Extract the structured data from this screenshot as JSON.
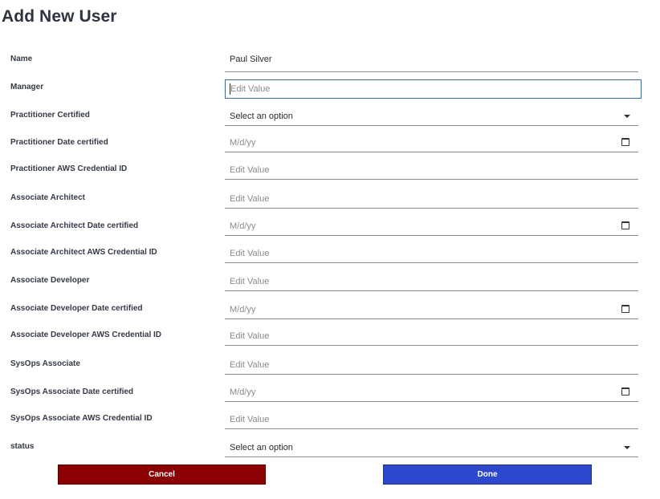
{
  "form": {
    "title": "Add New User",
    "fields": [
      {
        "label": "Name",
        "value": "Paul Silver",
        "placeholder": ""
      },
      {
        "label": "Manager",
        "value": "",
        "placeholder": "Edit Value"
      },
      {
        "label": "Practitioner Certified",
        "value": "Select an option",
        "placeholder": ""
      },
      {
        "label": "Practitioner Date certified",
        "value": "",
        "placeholder": "M/d/yy"
      },
      {
        "label": "Practitioner AWS Credential ID",
        "value": "",
        "placeholder": "Edit Value"
      },
      {
        "label": "Associate Architect",
        "value": "",
        "placeholder": "Edit Value"
      },
      {
        "label": "Associate Architect Date certified",
        "value": "",
        "placeholder": "M/d/yy"
      },
      {
        "label": "Associate Architect AWS Credential ID",
        "value": "",
        "placeholder": "Edit Value"
      },
      {
        "label": "Associate Developer",
        "value": "",
        "placeholder": "Edit Value"
      },
      {
        "label": "Associate Developer Date certified",
        "value": "",
        "placeholder": "M/d/yy"
      },
      {
        "label": "Associate Developer AWS Credential ID",
        "value": "",
        "placeholder": "Edit Value"
      },
      {
        "label": "SysOps Associate",
        "value": "",
        "placeholder": "Edit Value"
      },
      {
        "label": "SysOps Associate Date certified",
        "value": "",
        "placeholder": "M/d/yy"
      },
      {
        "label": "SysOps Associate AWS Credential ID",
        "value": "",
        "placeholder": "Edit Value"
      },
      {
        "label": "status",
        "value": "Select an option",
        "placeholder": ""
      }
    ],
    "cancel_label": "Cancel",
    "done_label": "Done"
  },
  "colors": {
    "cancel_button": "#8b0000",
    "done_button": "#2d48cc",
    "focus_border": "#3a6a9a"
  },
  "icons": {
    "dropdown": "chevron-down-icon",
    "date": "calendar-icon"
  }
}
